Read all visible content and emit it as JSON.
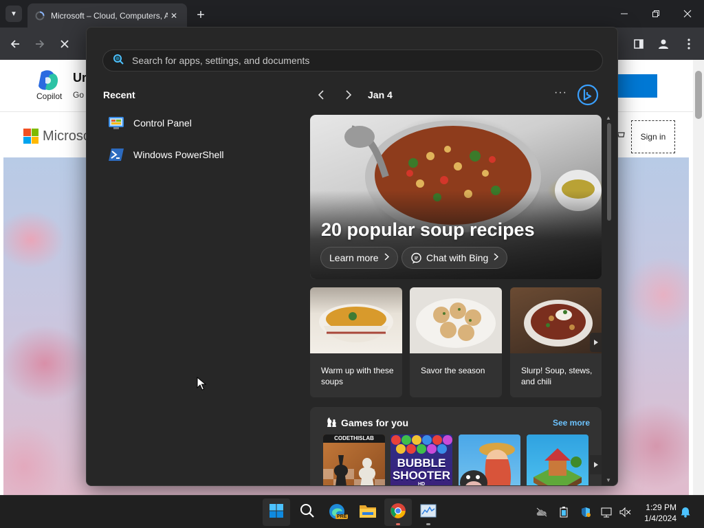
{
  "browser": {
    "tab_title": "Microsoft – Cloud, Computers, Apps & Gaming",
    "new_tab_symbol": "+",
    "close_symbol": "✕"
  },
  "webpage": {
    "copilot_label": "Copilot",
    "banner_heading_fragment": "Ur",
    "banner_sub_fragment": "Go",
    "brand_fragment": "Microso",
    "signin_label": "Sign in"
  },
  "start_menu": {
    "search": {
      "placeholder": "Search for apps, settings, and documents"
    },
    "recent": {
      "title": "Recent",
      "items": [
        {
          "label": "Control Panel",
          "icon": "control-panel-icon"
        },
        {
          "label": "Windows PowerShell",
          "icon": "powershell-icon"
        }
      ]
    },
    "feed": {
      "date": "Jan 4",
      "more_symbol": "···",
      "hero": {
        "title": "20 popular soup recipes",
        "learn_more": "Learn more",
        "chat_with_bing": "Chat with Bing"
      },
      "cards": [
        {
          "caption": "Warm up with these soups"
        },
        {
          "caption": "Savor the season"
        },
        {
          "caption": "Slurp! Soup, stews, and chili"
        }
      ],
      "games": {
        "title": "Games for you",
        "see_more": "See more",
        "tiles": [
          {
            "name": "CODETHISLAB"
          },
          {
            "name": "BUBBLE SHOOTER",
            "badge": "HD"
          },
          {
            "name": ""
          },
          {
            "name": ""
          }
        ]
      }
    }
  },
  "taskbar": {
    "time": "1:29 PM",
    "date": "1/4/2024",
    "edge_badge": "PRE"
  },
  "colors": {
    "accent": "#0078d4",
    "link": "#6cc3ff",
    "start_bg": "#272727",
    "card_bg": "#323232"
  }
}
